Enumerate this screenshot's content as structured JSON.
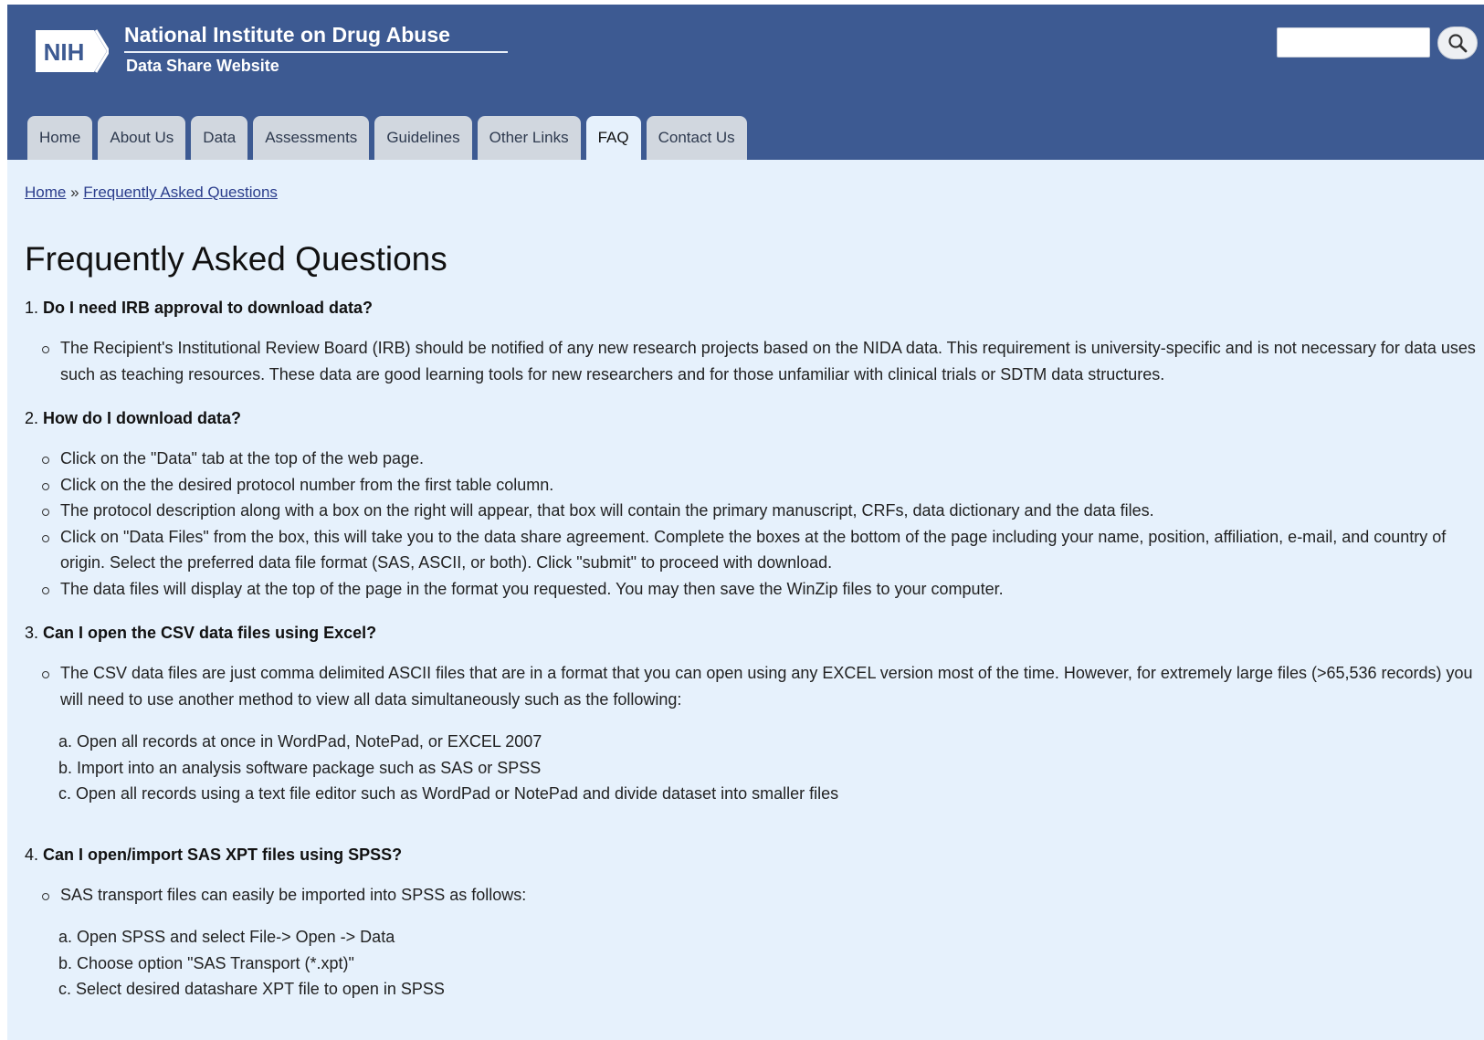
{
  "header": {
    "logo_text": "NIH",
    "title": "National Institute on Drug Abuse",
    "subtitle": "Data Share Website",
    "search": {
      "value": "",
      "placeholder": ""
    },
    "search_icon": "search-icon"
  },
  "tabs": [
    {
      "label": "Home",
      "active": false
    },
    {
      "label": "About Us",
      "active": false
    },
    {
      "label": "Data",
      "active": false
    },
    {
      "label": "Assessments",
      "active": false
    },
    {
      "label": "Guidelines",
      "active": false
    },
    {
      "label": "Other Links",
      "active": false
    },
    {
      "label": "FAQ",
      "active": true
    },
    {
      "label": "Contact Us",
      "active": false
    }
  ],
  "breadcrumb": {
    "home": "Home",
    "separator": "»",
    "current": "Frequently Asked Questions"
  },
  "main": {
    "title": "Frequently Asked Questions",
    "questions": [
      {
        "number": "1.",
        "question": "Do I need IRB approval to download data?",
        "bullets": [
          "The Recipient's Institutional Review Board (IRB) should be notified of any new research projects based on the NIDA data. This requirement is university-specific and is not necessary for data uses such as teaching resources. These data are good learning tools for new researchers and for those unfamiliar with clinical trials or SDTM data structures."
        ]
      },
      {
        "number": "2.",
        "question": "How do I download data?",
        "bullets": [
          "Click on the \"Data\" tab at the top of the web page.",
          "Click on the the desired protocol number from the first table column.",
          "The protocol description along with a box on the right will appear, that box will contain the primary manuscript, CRFs, data dictionary and the data files.",
          "Click on \"Data Files\" from the box, this will take you to the data share agreement. Complete the boxes at the bottom of the page including your name, position, affiliation, e-mail, and country of origin. Select the preferred data file format (SAS, ASCII, or both). Click \"submit\" to proceed with download.",
          "The data files will display at the top of the page in the format you requested. You may then save the WinZip files to your computer."
        ]
      },
      {
        "number": "3.",
        "question": "Can I open the CSV data files using Excel?",
        "bullets": [
          "The CSV data files are just comma delimited ASCII files that are in a format that you can open using any EXCEL version most of the time. However, for extremely large files (>65,536 records) you will need to use another method to view all data simultaneously such as the following:"
        ],
        "subitems": [
          "a. Open all records at once in WordPad, NotePad, or EXCEL 2007",
          "b. Import into an analysis software package such as SAS or SPSS",
          "c. Open all records using a text file editor such as WordPad or NotePad and divide dataset into smaller files"
        ]
      },
      {
        "number": "4.",
        "question": "Can I open/import SAS XPT files using SPSS?",
        "bullets": [
          "SAS transport files can easily be imported into SPSS as follows:"
        ],
        "subitems": [
          "a. Open SPSS and select File-> Open -> Data",
          "b. Choose option \"SAS Transport (*.xpt)\"",
          "c. Select desired datashare XPT file to open in SPSS"
        ]
      }
    ]
  }
}
